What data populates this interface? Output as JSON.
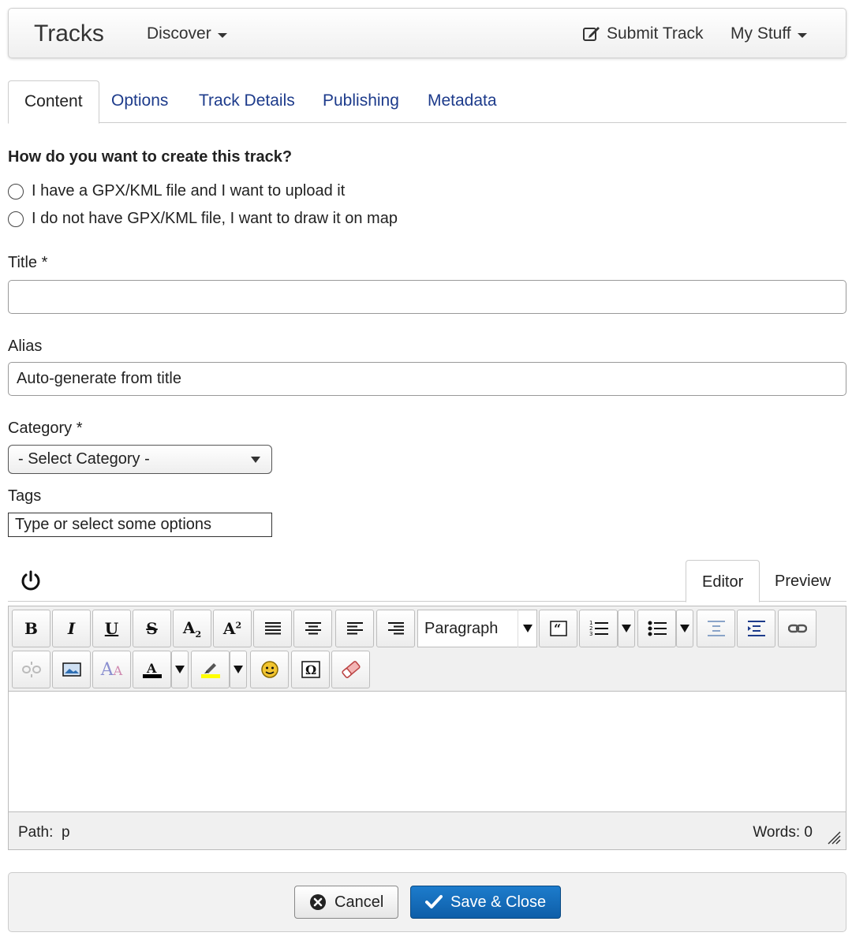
{
  "navbar": {
    "brand": "Tracks",
    "discover": "Discover",
    "submit_track": "Submit Track",
    "my_stuff": "My Stuff"
  },
  "tabs": [
    "Content",
    "Options",
    "Track Details",
    "Publishing",
    "Metadata"
  ],
  "active_tab": "Content",
  "form": {
    "question": "How do you want to create this track?",
    "radio_upload": "I have a GPX/KML file and I want to upload it",
    "radio_draw": "I do not have GPX/KML file, I want to draw it on map",
    "title_label": "Title *",
    "title_value": "",
    "alias_label": "Alias",
    "alias_placeholder": "Auto-generate from title",
    "category_label": "Category *",
    "category_selected": "- Select Category -",
    "tags_label": "Tags",
    "tags_placeholder": "Type or select some options"
  },
  "editor": {
    "tab_editor": "Editor",
    "tab_preview": "Preview",
    "format_value": "Paragraph",
    "path_label": "Path:",
    "path_value": "p",
    "words": "Words: 0",
    "icons": [
      "bold-icon",
      "italic-icon",
      "underline-icon",
      "strikethrough-icon",
      "subscript-icon",
      "superscript-icon",
      "align-justify-icon",
      "align-center-icon",
      "align-left-icon",
      "align-right-icon",
      "blockquote-icon",
      "numbered-list-icon",
      "bullet-list-icon",
      "outdent-icon",
      "indent-icon",
      "link-icon",
      "unlink-icon",
      "image-icon",
      "font-size-icon",
      "text-color-icon",
      "highlight-color-icon",
      "emoticon-icon",
      "special-character-icon",
      "eraser-icon"
    ]
  },
  "footer": {
    "cancel": "Cancel",
    "save_close": "Save & Close"
  },
  "colors": {
    "primary_button": "#0e5ea8",
    "tab_link": "#1d3b8b",
    "text_color_swatch": "#000000",
    "highlight_swatch": "#ffff00"
  }
}
